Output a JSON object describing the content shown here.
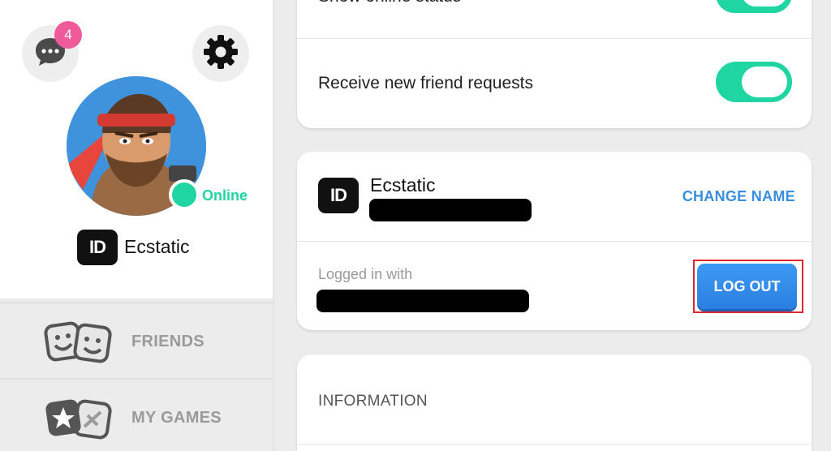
{
  "sidebar": {
    "notification_count": "4",
    "status": "Online",
    "profile": {
      "id_badge": "ID",
      "username": "Ecstatic"
    },
    "nav": [
      {
        "label": "FRIENDS",
        "icon": "friends-faces-icon"
      },
      {
        "label": "MY GAMES",
        "icon": "my-games-icon"
      }
    ],
    "icons": {
      "chat": "chat-bubble-icon",
      "settings": "gear-icon"
    }
  },
  "settings": {
    "top_row_label": "Show online status",
    "friend_requests_label": "Receive new friend requests",
    "friend_requests_enabled": true,
    "online_status_enabled": true
  },
  "account": {
    "id_badge": "ID",
    "username": "Ecstatic",
    "change_name_label": "CHANGE NAME",
    "logged_in_label": "Logged in with",
    "logout_label": "LOG OUT"
  },
  "information": {
    "label": "INFORMATION"
  },
  "colors": {
    "accent_green": "#1fd6a2",
    "accent_blue": "#3a8ee0",
    "badge_pink": "#ef5b9a",
    "highlight_red": "#e0252b"
  }
}
